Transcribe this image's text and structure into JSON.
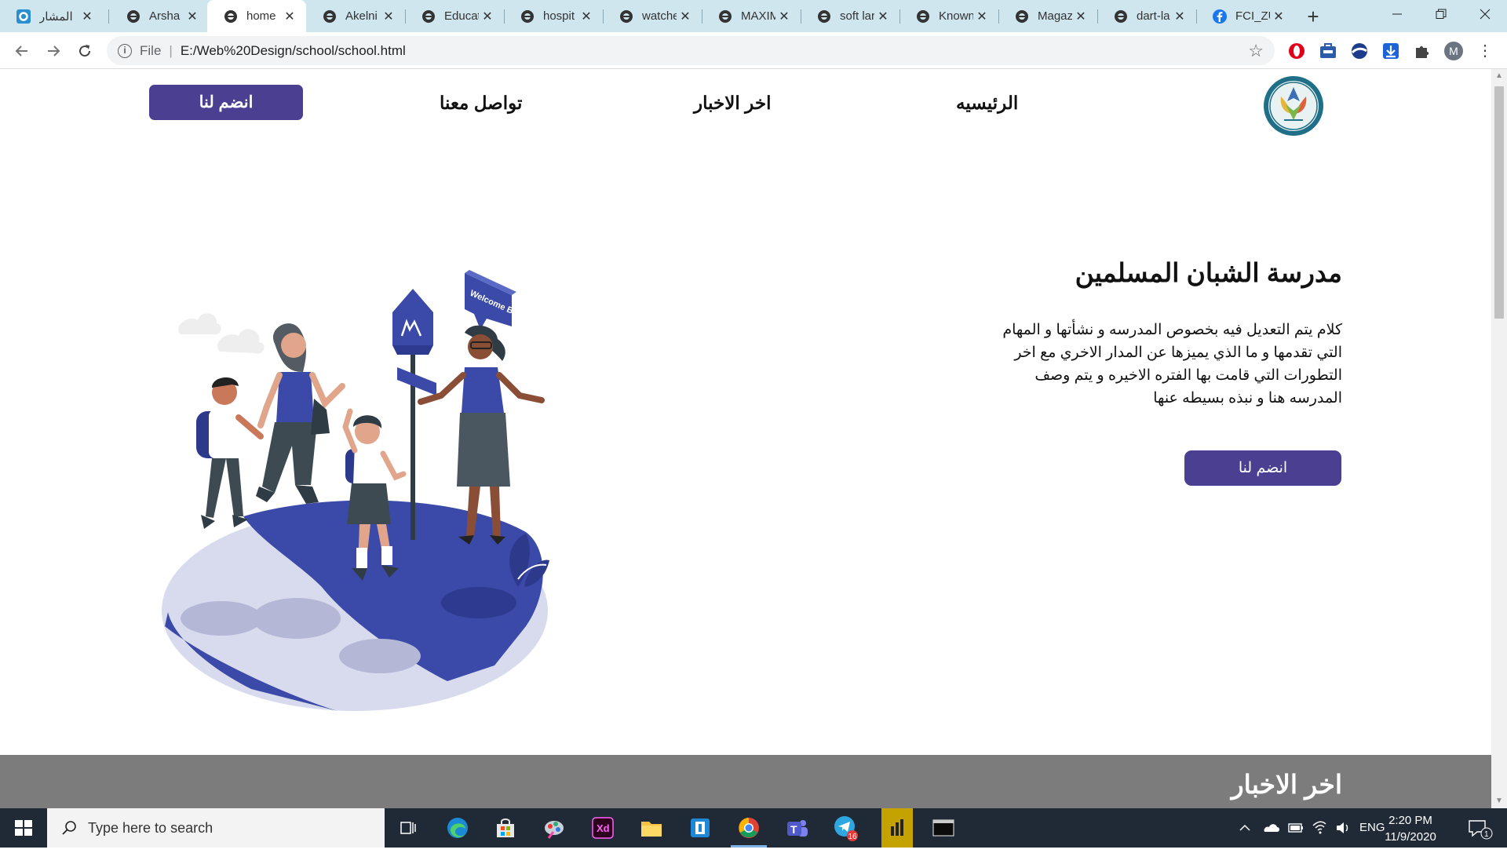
{
  "browser": {
    "tabs": [
      {
        "title": "المشار",
        "icon": "app-icon"
      },
      {
        "title": "Arsha",
        "icon": "globe-icon"
      },
      {
        "title": "home",
        "icon": "globe-icon",
        "active": true
      },
      {
        "title": "Akelni",
        "icon": "globe-icon"
      },
      {
        "title": "Educat",
        "icon": "globe-icon"
      },
      {
        "title": "hospit",
        "icon": "globe-icon"
      },
      {
        "title": "watche",
        "icon": "globe-icon"
      },
      {
        "title": "MAXIM",
        "icon": "globe-icon"
      },
      {
        "title": "soft lar",
        "icon": "globe-icon"
      },
      {
        "title": "Known",
        "icon": "globe-icon"
      },
      {
        "title": "Magaz",
        "icon": "globe-icon"
      },
      {
        "title": "dart-la",
        "icon": "globe-icon"
      },
      {
        "title": "FCI_ZU",
        "icon": "facebook-icon"
      }
    ],
    "close_glyph": "✕",
    "new_tab_glyph": "+",
    "address": {
      "scheme": "File",
      "path": "E:/Web%20Design/school/school.html"
    },
    "profile_initial": "M"
  },
  "site": {
    "nav": {
      "home": "الرئيسيه",
      "news": "اخر الاخبار",
      "contact": "تواصل معنا",
      "join": "انضم لنا"
    },
    "hero": {
      "title": "مدرسة الشبان المسلمين",
      "description": "كلام يتم التعديل فيه بخصوص المدرسه و نشأتها و المهام التي تقدمها و ما الذي يميزها عن المدار الاخري مع اخر التطورات التي قامت بها الفتره الاخيره و يتم وصف المدرسه هنا و نبذه بسيطه عنها",
      "cta": "انضم لنا",
      "sign_text": "Welcome Back!"
    },
    "news": {
      "title": "اخر الاخبار"
    }
  },
  "taskbar": {
    "search_placeholder": "Type here to search",
    "language": "ENG",
    "time": "2:20 PM",
    "date": "11/9/2020",
    "telegram_badge": "16",
    "notification_count": "1"
  },
  "colors": {
    "brand_purple": "#4a3f91",
    "illustration_blue": "#3b4aa8",
    "tab_strip": "#cfe6ef",
    "news_band": "#7c7c7c",
    "taskbar": "#1f2a36"
  }
}
